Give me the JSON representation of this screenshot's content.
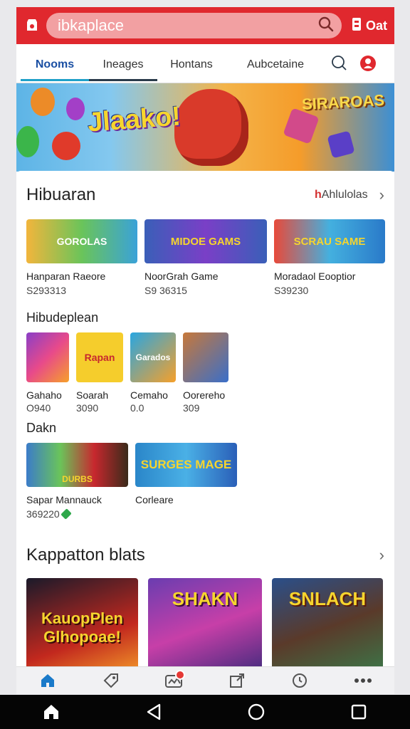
{
  "search": {
    "value": "",
    "placeholder": "ibkaplace"
  },
  "header": {
    "cart_label": "Oat"
  },
  "tabs": [
    {
      "label": "Nooms",
      "active": true
    },
    {
      "label": "Ineages"
    },
    {
      "label": "Hontans"
    },
    {
      "label": "Aubcetaine"
    }
  ],
  "banner": {
    "title_left": "Jlaako!",
    "title_right": "SIRAROAS"
  },
  "section1": {
    "title": "Hibuaran",
    "link_prefix": "h",
    "link_label": "Ahlulolas",
    "items": [
      {
        "thumb": "GOROLAS",
        "name": "Hanparan Raeore",
        "price": "S293313",
        "color": "#f2b53c"
      },
      {
        "thumb": "MIDOE GAMS",
        "name": "NoorGrah Game",
        "price": "S9 36315",
        "color": "#3a5fb8"
      },
      {
        "thumb": "SCRAU SAME",
        "name": "Moradaol Eooptior",
        "price": "S39230",
        "color": "#44b0df"
      }
    ]
  },
  "section2": {
    "title": "Hibudeplean",
    "items": [
      {
        "thumb": "",
        "name": "Gahaho",
        "price": "O940",
        "color": "#8a3fc7"
      },
      {
        "thumb": "Rapan",
        "name": "Soarah",
        "price": "3090",
        "color": "#f5cd2c"
      },
      {
        "thumb": "Garados",
        "name": "Cemaho",
        "price": "0.0",
        "color": "#29a6e1"
      },
      {
        "thumb": "",
        "name": "Oorereho",
        "price": "309",
        "color": "#c7783a"
      }
    ]
  },
  "section3": {
    "title": "Dakn",
    "items": [
      {
        "thumb": "DURBS",
        "name": "Sapar Mannauck",
        "price": "369220",
        "color": "#3c7cc9"
      },
      {
        "thumb": "SURGES MAGE",
        "name": "Corleare",
        "price": "",
        "color": "#2a86c9"
      }
    ]
  },
  "section4": {
    "title": "Kappatton blats",
    "items": [
      {
        "thumb": "KauopPlen Glhopoae!",
        "color": "#c2281e"
      },
      {
        "thumb": "SHAKN",
        "color": "#6a3db0"
      },
      {
        "thumb": "SNLACH",
        "color": "#2a4f8a"
      }
    ]
  },
  "colors": {
    "accent": "#e0282e",
    "tab_active": "#1a4fa3"
  },
  "bottom_nav": [
    "home-icon",
    "tag-icon",
    "games-icon",
    "share-icon",
    "clock-icon",
    "more-icon"
  ],
  "system_nav": [
    "home-icon",
    "back-icon",
    "recents-circle-icon",
    "overview-icon"
  ]
}
